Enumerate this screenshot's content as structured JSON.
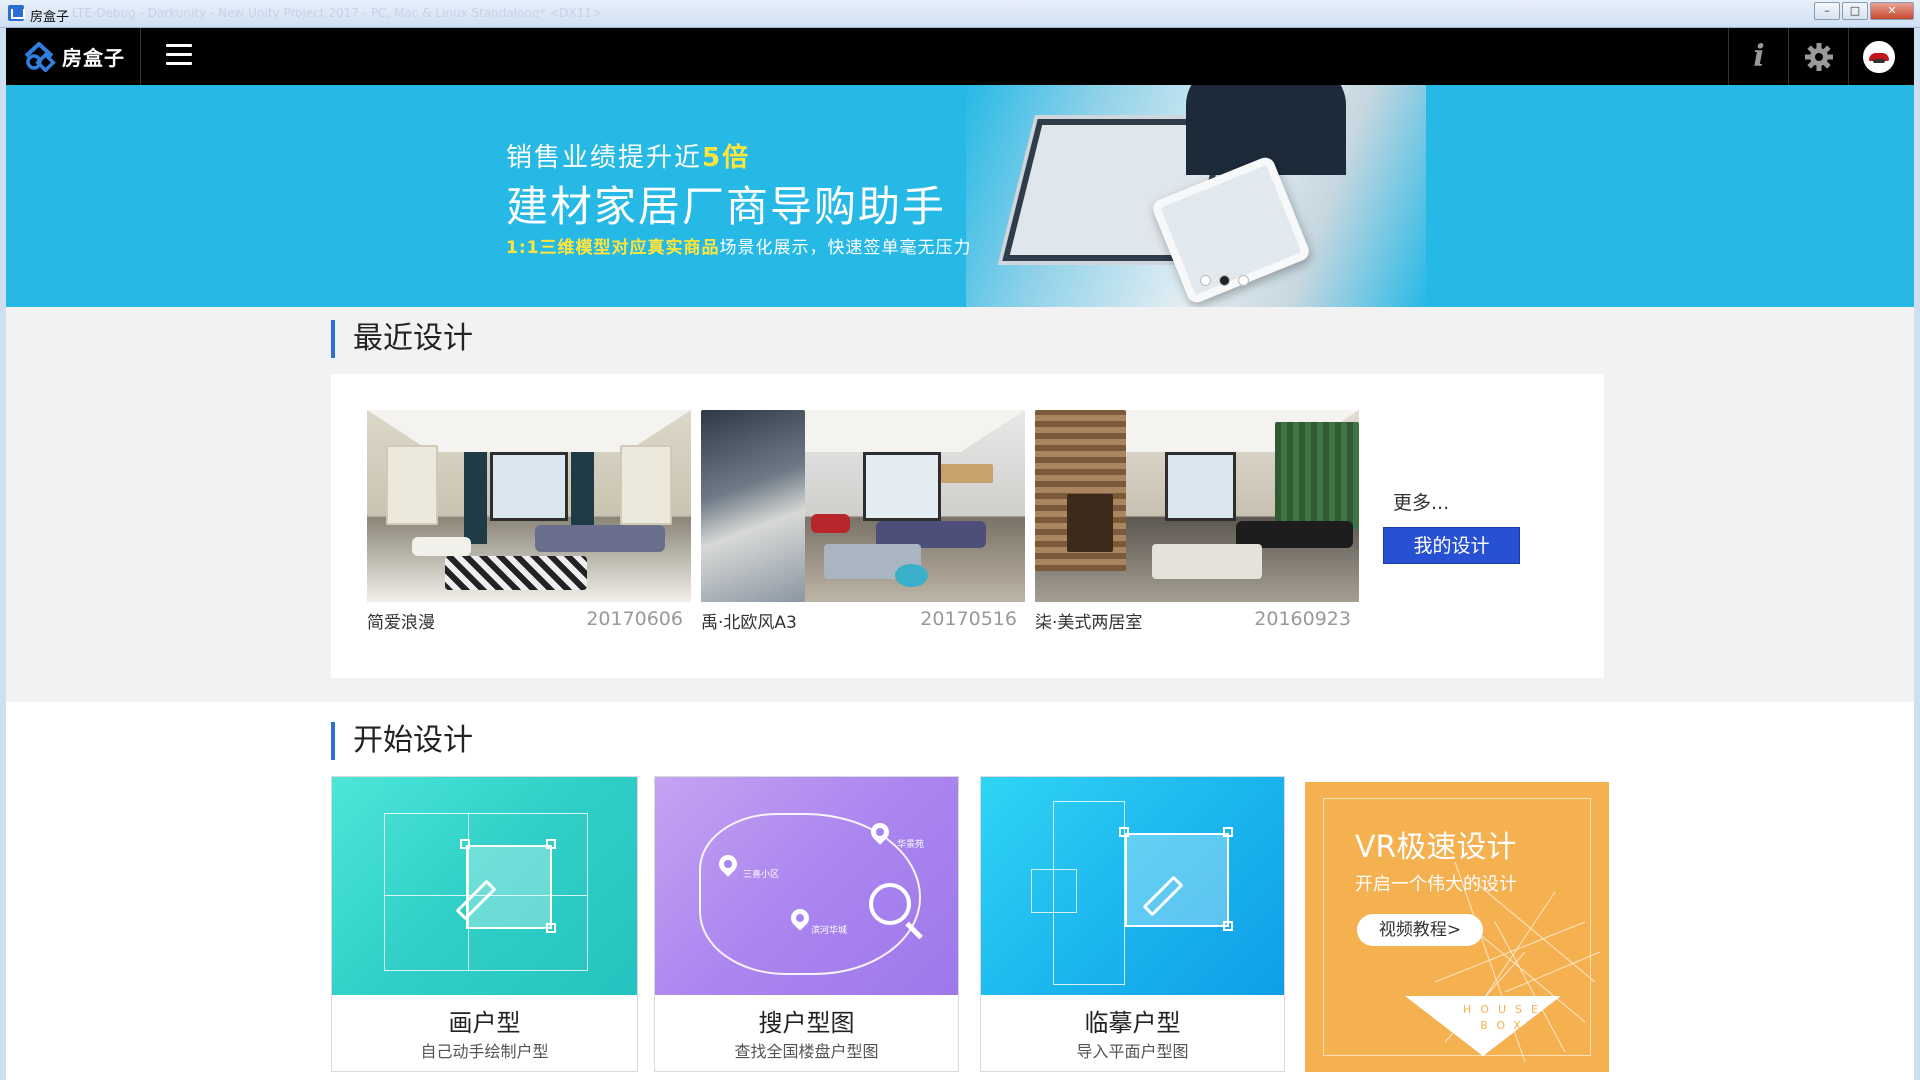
{
  "window": {
    "title": "房盒子",
    "faded_title": "LTE-Debug - Darkunity - New Unity Project 2017 - PC, Mac & Linux Standalone* <DX11>"
  },
  "topbar": {
    "logo_text": "房盒子",
    "icons": [
      "menu-icon",
      "info-icon",
      "gear-icon",
      "avatar"
    ]
  },
  "banner": {
    "line1_prefix": "销售业绩提升近",
    "line1_highlight": "5倍",
    "line2": "建材家居厂商导购助手",
    "line3_highlight": "1:1三维模型对应真实商品",
    "line3_rest": "场景化展示，快速签单毫无压力",
    "slides": 3,
    "active_slide": 2
  },
  "recent": {
    "title": "最近设计",
    "designs": [
      {
        "name": "简爱浪漫",
        "date": "20170606"
      },
      {
        "name": "禹·北欧风A3",
        "date": "20170516"
      },
      {
        "name": "柒·美式两居室",
        "date": "20160923"
      }
    ],
    "more_label": "更多...",
    "my_design_label": "我的设计"
  },
  "start": {
    "title": "开始设计",
    "cards": [
      {
        "title": "画户型",
        "subtitle": "自己动手绘制户型"
      },
      {
        "title": "搜户型图",
        "subtitle": "查找全国楼盘户型图"
      },
      {
        "title": "临摹户型",
        "subtitle": "导入平面户型图"
      }
    ],
    "map_labels": [
      "三喜小区",
      "华景苑",
      "滨河华城"
    ],
    "vr": {
      "title": "VR极速设计",
      "subtitle": "开启一个伟大的设计",
      "button": "视频教程>",
      "logo_line1": "HOUSE",
      "logo_line2": "BOX"
    }
  },
  "colors": {
    "banner_bg": "#27b9e6",
    "accent_blue": "#2750d3",
    "section_bar": "#2f6ed8",
    "highlight_yellow": "#ffe43b",
    "vr_orange": "#f5b04f"
  }
}
